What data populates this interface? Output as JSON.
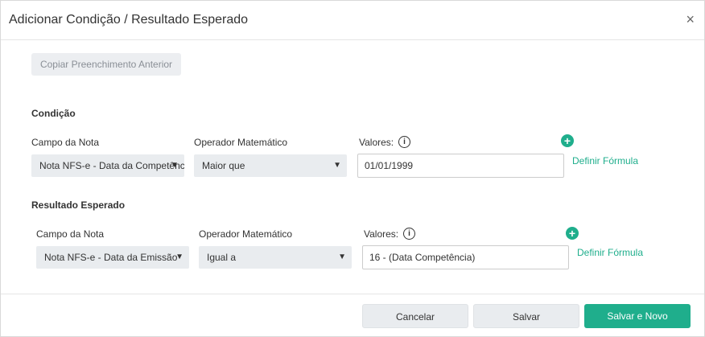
{
  "dialog": {
    "title": "Adicionar Condição / Resultado Esperado",
    "close_symbol": "×"
  },
  "copy_button": "Copiar Preenchimento Anterior",
  "condition": {
    "section_title": "Condição",
    "campo_label": "Campo da Nota",
    "campo_value": "Nota NFS-e - Data da Competência",
    "operador_label": "Operador Matemático",
    "operador_value": "Maior que",
    "valores_label": "Valores:",
    "valores_value": "01/01/1999",
    "formula_link": "Definir Fórmula"
  },
  "result": {
    "section_title": "Resultado Esperado",
    "campo_label": "Campo da Nota",
    "campo_value": "Nota NFS-e - Data da Emissão",
    "operador_label": "Operador Matemático",
    "operador_value": "Igual a",
    "valores_label": "Valores:",
    "valores_value": "16 - (Data Competência)",
    "formula_link": "Definir Fórmula"
  },
  "footer": {
    "cancel": "Cancelar",
    "save": "Salvar",
    "save_new": "Salvar e Novo"
  },
  "colors": {
    "accent": "#1fae8c"
  }
}
